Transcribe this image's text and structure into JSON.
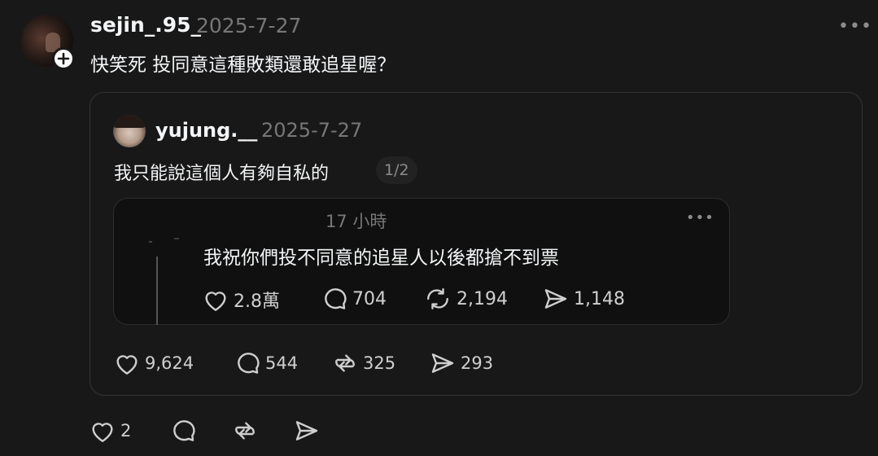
{
  "post": {
    "username": "sejin_.95_",
    "timestamp": "2025-7-27",
    "text": "快笑死 投同意這種敗類還敢追星喔？",
    "more": "•••",
    "actions": {
      "likes": "2"
    }
  },
  "quote": {
    "username": "yujung.__",
    "timestamp": "2025-7-27",
    "text": "我只能說這個人有夠自私的",
    "page": "1/2",
    "actions": {
      "likes": "9,624",
      "replies": "544",
      "reposts": "325",
      "shares": "293"
    },
    "embedded": {
      "time": "17 小時",
      "text": "我祝你們投不同意的追星人以後都搶不到票",
      "more": "•••",
      "actions": {
        "likes": "2.8萬",
        "replies": "704",
        "reposts": "2,194",
        "shares": "1,148"
      }
    }
  }
}
